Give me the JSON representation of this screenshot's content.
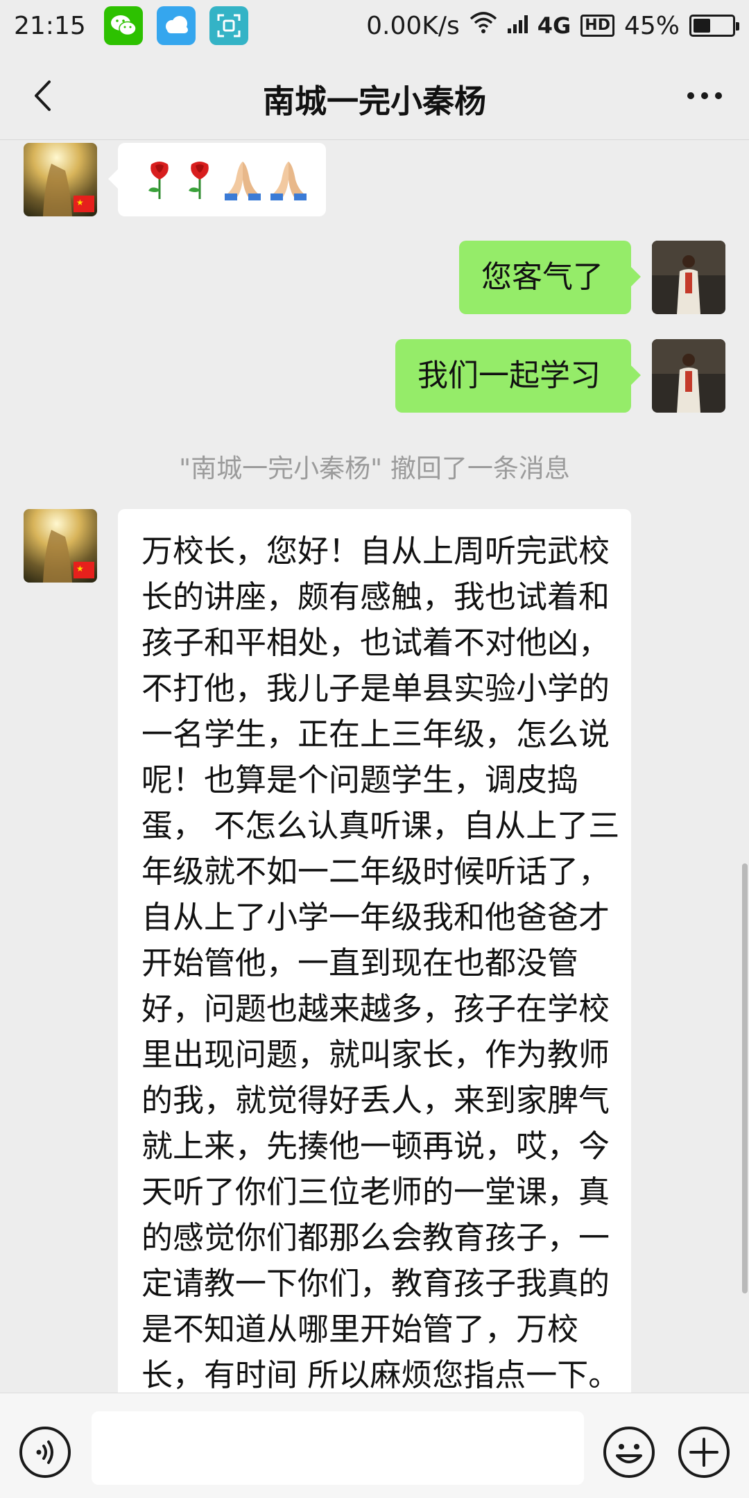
{
  "status_bar": {
    "time": "21:15",
    "network_speed": "0.00K/s",
    "network_type": "4G",
    "hd_label": "HD",
    "battery_percent": "45%",
    "battery_level": 0.45,
    "icons": [
      "wechat-icon",
      "weather-icon",
      "scan-icon",
      "wifi-icon",
      "signal-icon",
      "battery-icon"
    ]
  },
  "header": {
    "title": "南城一完小秦杨",
    "back_icon": "chevron-left-icon",
    "more_icon": "more-dots-icon"
  },
  "messages": [
    {
      "side": "left",
      "type": "emoji",
      "content": [
        "rose",
        "rose",
        "folded-hands",
        "folded-hands"
      ]
    },
    {
      "side": "right",
      "type": "text",
      "text": "您客气了"
    },
    {
      "side": "right",
      "type": "text",
      "text": "我们一起学习"
    },
    {
      "type": "system",
      "text": "\"南城一完小秦杨\" 撤回了一条消息"
    },
    {
      "side": "left",
      "type": "text",
      "lines": [
        "万校长，您好！自从上周听完武校",
        "长的讲座，颇有感触，我也试着和",
        "孩子和平相处，也试着不对他凶，",
        "不打他，我儿子是单县实验小学的",
        "一名学生，正在上三年级，怎么说",
        "呢！也算是个问题学生，调皮捣",
        "蛋， 不怎么认真听课，自从上了三",
        "年级就不如一二年级时候听话了，",
        "自从上了小学一年级我和他爸爸才",
        "开始管他，一直到现在也都没管",
        "好，问题也越来越多，孩子在学校",
        "里出现问题，就叫家长，作为教师",
        "的我，就觉得好丢人，来到家脾气",
        "就上来，先揍他一顿再说，哎，今",
        "天听了你们三位老师的一堂课，真",
        "的感觉你们都那么会教育孩子，一",
        "定请教一下你们，教育孩子我真的",
        "是不知道从哪里开始管了，万校",
        "长，有时间 所以麻烦您指点一下。"
      ]
    }
  ],
  "input_bar": {
    "voice_icon": "voice-icon",
    "emoji_icon": "emoji-icon",
    "plus_icon": "plus-icon",
    "input_value": ""
  },
  "colors": {
    "background": "#ededed",
    "sent_bubble": "#95ec69",
    "received_bubble": "#ffffff",
    "system_text": "#9b9b9b"
  }
}
